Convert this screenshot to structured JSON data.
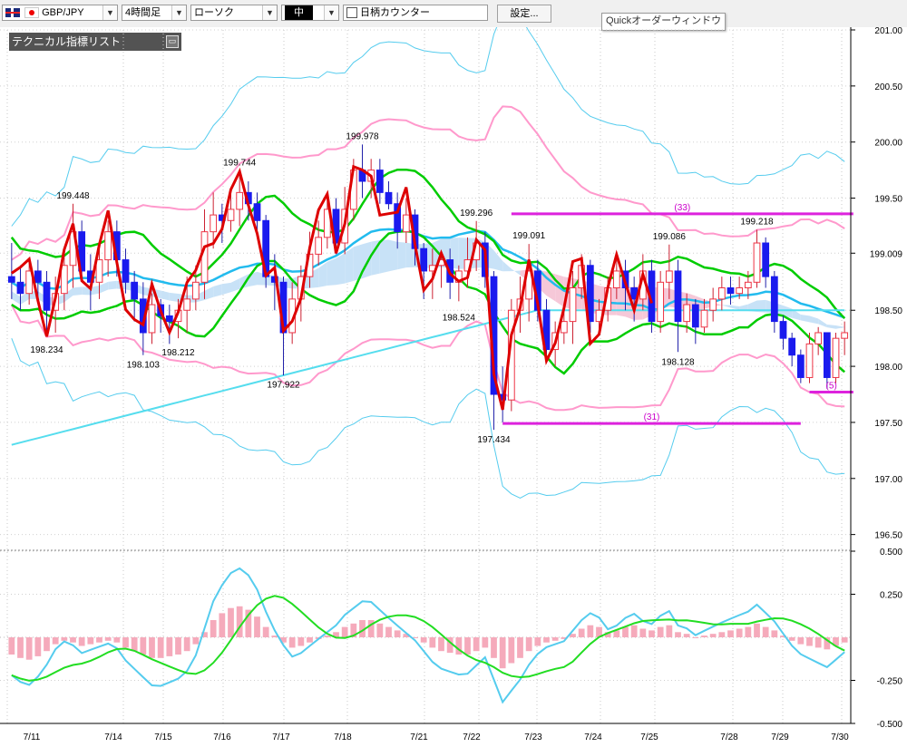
{
  "toolbar": {
    "symbol": "GBP/JPY",
    "timeframe": "4時間足",
    "chart_style": "ローソク",
    "size": "中",
    "stock_counter": "日柄カウンター",
    "settings": "設定...",
    "quick_order": "Quickオーダーウィンドウ",
    "indicator_list": "テクニカル指標リスト"
  },
  "colors": {
    "bull": "#ee3344",
    "bear": "#1a1aee",
    "tenkan": "#00cc00",
    "midline": "#22bbee",
    "sma_long": "#55ddee",
    "bollinger": "#ff99cc",
    "band_outer": "#55ccee",
    "fib_line": "#dd0000",
    "marker": "#dd22dd",
    "macd": "#55ccee",
    "signal": "#22dd22",
    "histogram": "#f5aabb"
  },
  "chart_data": {
    "type": "candlestick",
    "symbol": "GBP/JPY",
    "timeframe": "4時間足",
    "ylim": [
      196.4,
      201.0
    ],
    "y_ticks": [
      "201.00",
      "200.50",
      "200.00",
      "199.50",
      "199.009",
      "198.50",
      "198.00",
      "197.50",
      "197.00",
      "196.50"
    ],
    "x_labels": [
      "7/11",
      "7/14",
      "7/15",
      "7/16",
      "7/17",
      "7/18",
      "7/21",
      "7/22",
      "7/23",
      "7/24",
      "7/25",
      "7/28",
      "7/29",
      "7/30"
    ],
    "candles": [
      [
        198.8,
        198.75,
        198.6,
        199.1
      ],
      [
        198.75,
        198.65,
        198.5,
        198.9
      ],
      [
        198.65,
        198.85,
        198.55,
        198.95
      ],
      [
        198.85,
        198.75,
        198.6,
        198.95
      ],
      [
        198.75,
        198.5,
        198.3,
        198.85
      ],
      [
        198.5,
        198.65,
        198.3,
        198.8
      ],
      [
        198.65,
        198.9,
        198.5,
        199.0
      ],
      [
        198.9,
        199.2,
        198.7,
        199.45
      ],
      [
        199.2,
        198.85,
        198.8,
        199.3
      ],
      [
        198.85,
        198.75,
        198.5,
        199.0
      ],
      [
        198.75,
        198.95,
        198.6,
        199.1
      ],
      [
        198.95,
        199.2,
        198.8,
        199.3
      ],
      [
        199.2,
        198.95,
        198.8,
        199.3
      ],
      [
        198.95,
        198.75,
        198.65,
        199.05
      ],
      [
        198.75,
        198.6,
        198.4,
        198.85
      ],
      [
        198.6,
        198.3,
        198.1,
        198.75
      ],
      [
        198.3,
        198.55,
        198.2,
        198.65
      ],
      [
        198.55,
        198.45,
        198.3,
        198.6
      ],
      [
        198.45,
        198.4,
        198.2,
        198.55
      ],
      [
        198.4,
        198.5,
        198.25,
        198.6
      ],
      [
        198.5,
        198.6,
        198.3,
        198.8
      ],
      [
        198.6,
        198.75,
        198.5,
        198.9
      ],
      [
        198.75,
        199.2,
        198.6,
        199.4
      ],
      [
        199.2,
        199.35,
        199.05,
        199.55
      ],
      [
        199.35,
        199.3,
        199.1,
        199.45
      ],
      [
        199.3,
        199.4,
        199.2,
        199.55
      ],
      [
        199.4,
        199.55,
        199.25,
        199.74
      ],
      [
        199.55,
        199.45,
        199.3,
        199.65
      ],
      [
        199.45,
        199.3,
        199.2,
        199.55
      ],
      [
        199.3,
        198.8,
        198.7,
        199.35
      ],
      [
        198.8,
        198.75,
        198.5,
        199.0
      ],
      [
        198.75,
        198.3,
        197.92,
        198.8
      ],
      [
        198.3,
        198.6,
        198.2,
        198.75
      ],
      [
        198.6,
        198.8,
        198.4,
        198.9
      ],
      [
        198.8,
        199.0,
        198.7,
        199.2
      ],
      [
        199.0,
        199.15,
        198.9,
        199.3
      ],
      [
        199.15,
        199.4,
        199.05,
        199.5
      ],
      [
        199.4,
        199.1,
        199.0,
        199.5
      ],
      [
        199.1,
        199.4,
        199.0,
        199.6
      ],
      [
        199.4,
        199.75,
        199.3,
        199.85
      ],
      [
        199.75,
        199.65,
        199.5,
        199.978
      ],
      [
        199.65,
        199.75,
        199.5,
        199.85
      ],
      [
        199.75,
        199.55,
        199.45,
        199.85
      ],
      [
        199.55,
        199.45,
        199.4,
        199.65
      ],
      [
        199.45,
        199.2,
        199.05,
        199.55
      ],
      [
        199.2,
        199.35,
        199.1,
        199.5
      ],
      [
        199.35,
        199.05,
        198.9,
        199.4
      ],
      [
        199.05,
        198.85,
        198.6,
        199.1
      ],
      [
        198.85,
        198.9,
        198.6,
        199.05
      ],
      [
        198.9,
        198.95,
        198.7,
        199.0
      ],
      [
        198.95,
        198.75,
        198.6,
        199.05
      ],
      [
        198.75,
        198.85,
        198.58,
        198.9
      ],
      [
        198.85,
        198.95,
        198.7,
        199.15
      ],
      [
        198.95,
        199.1,
        198.85,
        199.296
      ],
      [
        199.1,
        198.8,
        198.7,
        199.2
      ],
      [
        198.8,
        197.75,
        197.434,
        198.85
      ],
      [
        197.75,
        197.7,
        197.5,
        198.0
      ],
      [
        197.7,
        198.5,
        197.6,
        198.6
      ],
      [
        198.5,
        198.6,
        198.3,
        198.8
      ],
      [
        198.6,
        198.85,
        198.4,
        199.091
      ],
      [
        198.85,
        198.5,
        198.4,
        198.95
      ],
      [
        198.5,
        198.15,
        198.05,
        198.6
      ],
      [
        198.15,
        198.3,
        198.0,
        198.4
      ],
      [
        198.3,
        198.4,
        198.2,
        198.5
      ],
      [
        198.4,
        198.7,
        198.2,
        198.85
      ],
      [
        198.7,
        198.9,
        198.6,
        199.0
      ],
      [
        198.9,
        198.4,
        198.3,
        198.95
      ],
      [
        198.4,
        198.5,
        198.3,
        198.6
      ],
      [
        198.5,
        198.7,
        198.4,
        198.8
      ],
      [
        198.7,
        198.85,
        198.6,
        198.95
      ],
      [
        198.85,
        198.7,
        198.5,
        198.95
      ],
      [
        198.7,
        198.6,
        198.4,
        198.8
      ],
      [
        198.6,
        198.85,
        198.5,
        199.0
      ],
      [
        198.85,
        198.4,
        198.3,
        198.95
      ],
      [
        198.4,
        198.75,
        198.3,
        198.85
      ],
      [
        198.75,
        198.85,
        198.6,
        199.086
      ],
      [
        198.85,
        198.4,
        198.128,
        198.95
      ],
      [
        198.4,
        198.55,
        198.3,
        198.65
      ],
      [
        198.55,
        198.35,
        198.2,
        198.6
      ],
      [
        198.35,
        198.5,
        198.3,
        198.6
      ],
      [
        198.5,
        198.6,
        198.4,
        198.7
      ],
      [
        198.6,
        198.7,
        198.5,
        198.8
      ],
      [
        198.7,
        198.65,
        198.55,
        198.8
      ],
      [
        198.65,
        198.7,
        198.6,
        198.8
      ],
      [
        198.7,
        198.75,
        198.6,
        198.85
      ],
      [
        198.75,
        199.1,
        198.7,
        199.218
      ],
      [
        199.1,
        198.8,
        198.7,
        199.15
      ],
      [
        198.8,
        198.4,
        198.3,
        198.85
      ],
      [
        198.4,
        198.25,
        198.15,
        198.45
      ],
      [
        198.25,
        198.1,
        198.0,
        198.3
      ],
      [
        198.1,
        197.9,
        197.85,
        198.15
      ],
      [
        197.9,
        198.2,
        197.85,
        198.3
      ],
      [
        198.2,
        198.3,
        198.1,
        198.35
      ],
      [
        198.3,
        197.9,
        197.8,
        198.3
      ],
      [
        197.9,
        198.25,
        197.85,
        198.3
      ],
      [
        198.25,
        198.3,
        198.1,
        198.4
      ]
    ],
    "tenkan": [
      198.35,
      198.4,
      198.3,
      198.1,
      198.0
    ],
    "high_labels": [
      {
        "text": "199.448",
        "i": 7,
        "v": 199.448
      },
      {
        "text": "199.744",
        "i": 26,
        "v": 199.744
      },
      {
        "text": "199.978",
        "i": 40,
        "v": 199.978
      },
      {
        "text": "199.296",
        "i": 53,
        "v": 199.296
      },
      {
        "text": "199.091",
        "i": 59,
        "v": 199.091
      },
      {
        "text": "199.086",
        "i": 75,
        "v": 199.086
      },
      {
        "text": "199.218",
        "i": 85,
        "v": 199.218
      }
    ],
    "low_labels": [
      {
        "text": "198.234",
        "i": 4,
        "v": 198.234
      },
      {
        "text": "198.103",
        "i": 15,
        "v": 198.103
      },
      {
        "text": "198.212",
        "i": 19,
        "v": 198.212
      },
      {
        "text": "197.922",
        "i": 31,
        "v": 197.922
      },
      {
        "text": "198.524",
        "i": 51,
        "v": 198.524
      },
      {
        "text": "197.434",
        "i": 55,
        "v": 197.434
      },
      {
        "text": "198.128",
        "i": 76,
        "v": 198.128
      }
    ],
    "count_markers": [
      {
        "text": "(33)",
        "i1": 57,
        "i2": 96,
        "v": 199.36
      },
      {
        "text": "(31)",
        "i1": 56,
        "i2": 90,
        "v": 197.49
      },
      {
        "text": "(5)",
        "i1": 91,
        "i2": 96,
        "v": 197.77
      }
    ],
    "macd_ylim": [
      -0.5,
      0.5
    ],
    "macd_ticks": [
      "0.500",
      "0.250",
      "-0.250",
      "-0.500"
    ],
    "histogram": [
      -0.1,
      -0.12,
      -0.13,
      -0.11,
      -0.08,
      -0.04,
      -0.02,
      -0.03,
      -0.05,
      -0.04,
      -0.03,
      -0.02,
      -0.03,
      -0.06,
      -0.08,
      -0.1,
      -0.12,
      -0.12,
      -0.11,
      -0.1,
      -0.08,
      -0.04,
      0.03,
      0.1,
      0.14,
      0.17,
      0.18,
      0.16,
      0.12,
      0.06,
      0.01,
      -0.03,
      -0.06,
      -0.05,
      -0.03,
      -0.01,
      0.01,
      0.03,
      0.06,
      0.08,
      0.1,
      0.1,
      0.08,
      0.06,
      0.04,
      0.02,
      0.0,
      -0.03,
      -0.06,
      -0.08,
      -0.09,
      -0.1,
      -0.1,
      -0.08,
      -0.06,
      -0.12,
      -0.18,
      -0.15,
      -0.12,
      -0.08,
      -0.05,
      -0.03,
      -0.02,
      -0.01,
      0.02,
      0.05,
      0.07,
      0.06,
      0.03,
      0.04,
      0.06,
      0.07,
      0.05,
      0.04,
      0.06,
      0.07,
      0.03,
      0.02,
      0.0,
      0.01,
      0.02,
      0.03,
      0.04,
      0.05,
      0.06,
      0.08,
      0.06,
      0.04,
      0.01,
      -0.02,
      -0.04,
      -0.05,
      -0.06,
      -0.07,
      -0.05,
      -0.03
    ]
  }
}
